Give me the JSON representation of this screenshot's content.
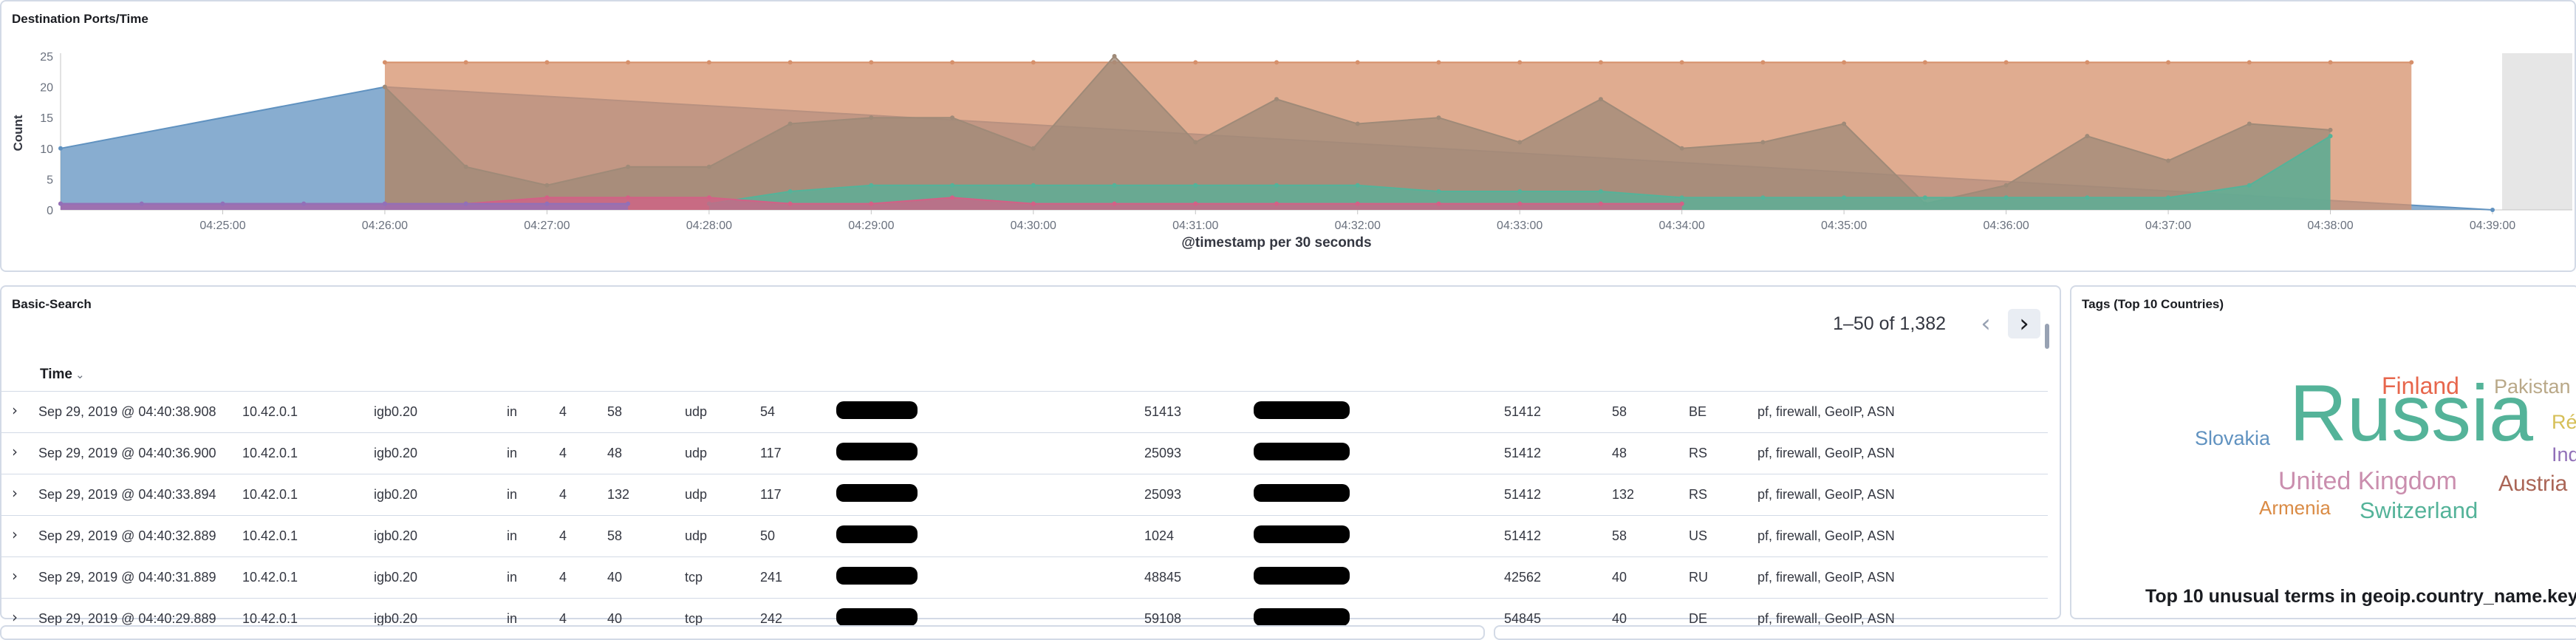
{
  "chart_panel": {
    "title": "Destination Ports/Time",
    "ylabel": "Count",
    "xlabel": "@timestamp per 30 seconds"
  },
  "chart_data": {
    "type": "area",
    "title": "Destination Ports/Time",
    "xlabel": "@timestamp per 30 seconds",
    "ylabel": "Count",
    "ylim": [
      0,
      25
    ],
    "yticks": [
      0,
      5,
      10,
      15,
      20,
      25
    ],
    "x": [
      "04:24:00",
      "04:24:30",
      "04:25:00",
      "04:25:30",
      "04:26:00",
      "04:26:30",
      "04:27:00",
      "04:27:30",
      "04:28:00",
      "04:28:30",
      "04:29:00",
      "04:29:30",
      "04:30:00",
      "04:30:30",
      "04:31:00",
      "04:31:30",
      "04:32:00",
      "04:32:30",
      "04:33:00",
      "04:33:30",
      "04:34:00",
      "04:34:30",
      "04:35:00",
      "04:35:30",
      "04:36:00",
      "04:36:30",
      "04:37:00",
      "04:37:30",
      "04:38:00",
      "04:38:30",
      "04:39:00"
    ],
    "xticks": [
      "04:25:00",
      "04:26:00",
      "04:27:00",
      "04:28:00",
      "04:29:00",
      "04:30:00",
      "04:31:00",
      "04:32:00",
      "04:33:00",
      "04:34:00",
      "04:35:00",
      "04:36:00",
      "04:37:00",
      "04:38:00",
      "04:39:00"
    ],
    "grid": false,
    "legend": "none",
    "series": [
      {
        "color": "#6092c0",
        "values": [
          10,
          null,
          null,
          null,
          20,
          null,
          null,
          null,
          null,
          null,
          null,
          null,
          null,
          null,
          null,
          null,
          null,
          null,
          null,
          null,
          null,
          null,
          null,
          null,
          null,
          null,
          null,
          null,
          null,
          null,
          0
        ]
      },
      {
        "color": "#d6906b",
        "values": [
          null,
          null,
          null,
          null,
          24,
          24,
          24,
          24,
          24,
          24,
          24,
          24,
          24,
          24,
          24,
          24,
          24,
          24,
          24,
          24,
          24,
          24,
          24,
          24,
          24,
          24,
          24,
          24,
          24,
          24,
          null
        ]
      },
      {
        "color": "#9f8a78",
        "values": [
          null,
          null,
          null,
          null,
          20,
          7,
          4,
          7,
          7,
          14,
          15,
          15,
          10,
          25,
          11,
          18,
          14,
          15,
          11,
          18,
          10,
          11,
          14,
          1,
          4,
          12,
          8,
          14,
          13,
          null,
          null
        ]
      },
      {
        "color": "#54b399",
        "values": [
          null,
          null,
          null,
          null,
          null,
          null,
          null,
          null,
          1,
          3,
          4,
          4,
          4,
          4,
          4,
          4,
          4,
          3,
          3,
          3,
          2,
          2,
          2,
          2,
          2,
          2,
          2,
          4,
          12,
          null,
          null
        ]
      },
      {
        "color": "#d36086",
        "values": [
          1,
          null,
          null,
          null,
          1,
          1,
          2,
          2,
          2,
          1,
          1,
          2,
          1,
          1,
          1,
          1,
          1,
          1,
          1,
          1,
          1,
          null,
          null,
          null,
          null,
          null,
          null,
          null,
          null,
          null,
          null
        ]
      },
      {
        "color": "#9170b8",
        "values": [
          1,
          1,
          1,
          1,
          1,
          1,
          1,
          1,
          null,
          null,
          null,
          null,
          null,
          null,
          null,
          null,
          null,
          null,
          null,
          null,
          null,
          null,
          null,
          null,
          null,
          null,
          null,
          null,
          null,
          null,
          null
        ]
      }
    ]
  },
  "search_panel": {
    "title": "Basic-Search",
    "pager_text": "1–50 of 1,382",
    "prev_icon": "chevron-left-icon",
    "next_icon": "chevron-right-icon",
    "column_time": "Time",
    "sort_icon": "⌄",
    "expand_icon": "›",
    "rows": [
      {
        "time": "Sep 29, 2019 @ 04:40:38.908",
        "ip": "10.42.0.1",
        "iface": "igb0.20",
        "dir": "in",
        "ver": "4",
        "len": "58",
        "proto": "udp",
        "n1": "54",
        "sport": "51413",
        "dport": "51412",
        "n2": "58",
        "cc": "BE",
        "tags": "pf, firewall, GeoIP, ASN"
      },
      {
        "time": "Sep 29, 2019 @ 04:40:36.900",
        "ip": "10.42.0.1",
        "iface": "igb0.20",
        "dir": "in",
        "ver": "4",
        "len": "48",
        "proto": "udp",
        "n1": "117",
        "sport": "25093",
        "dport": "51412",
        "n2": "48",
        "cc": "RS",
        "tags": "pf, firewall, GeoIP, ASN"
      },
      {
        "time": "Sep 29, 2019 @ 04:40:33.894",
        "ip": "10.42.0.1",
        "iface": "igb0.20",
        "dir": "in",
        "ver": "4",
        "len": "132",
        "proto": "udp",
        "n1": "117",
        "sport": "25093",
        "dport": "51412",
        "n2": "132",
        "cc": "RS",
        "tags": "pf, firewall, GeoIP, ASN"
      },
      {
        "time": "Sep 29, 2019 @ 04:40:32.889",
        "ip": "10.42.0.1",
        "iface": "igb0.20",
        "dir": "in",
        "ver": "4",
        "len": "58",
        "proto": "udp",
        "n1": "50",
        "sport": "1024",
        "dport": "51412",
        "n2": "58",
        "cc": "US",
        "tags": "pf, firewall, GeoIP, ASN"
      },
      {
        "time": "Sep 29, 2019 @ 04:40:31.889",
        "ip": "10.42.0.1",
        "iface": "igb0.20",
        "dir": "in",
        "ver": "4",
        "len": "40",
        "proto": "tcp",
        "n1": "241",
        "sport": "48845",
        "dport": "42562",
        "n2": "40",
        "cc": "RU",
        "tags": "pf, firewall, GeoIP, ASN"
      },
      {
        "time": "Sep 29, 2019 @ 04:40:29.889",
        "ip": "10.42.0.1",
        "iface": "igb0.20",
        "dir": "in",
        "ver": "4",
        "len": "40",
        "proto": "tcp",
        "n1": "242",
        "sport": "59108",
        "dport": "54845",
        "n2": "40",
        "cc": "DE",
        "tags": "pf, firewall, GeoIP, ASN"
      }
    ]
  },
  "tags_panel": {
    "title": "Tags (Top 10 Countries)",
    "caption": "Top 10 unusual terms in geoip.country_name.keyw",
    "words": [
      {
        "text": "Russia",
        "color": "#54b399"
      },
      {
        "text": "Finland",
        "color": "#e7664c"
      },
      {
        "text": "Pakistan",
        "color": "#b9a888"
      },
      {
        "text": "Slovakia",
        "color": "#6092c0"
      },
      {
        "text": "Ré",
        "color": "#d6bf57"
      },
      {
        "text": "Ind",
        "color": "#9170b8"
      },
      {
        "text": "United Kingdom",
        "color": "#ca8eae"
      },
      {
        "text": "Austria",
        "color": "#aa6556"
      },
      {
        "text": "Armenia",
        "color": "#da8b45"
      },
      {
        "text": "Switzerland",
        "color": "#54b399"
      }
    ]
  }
}
